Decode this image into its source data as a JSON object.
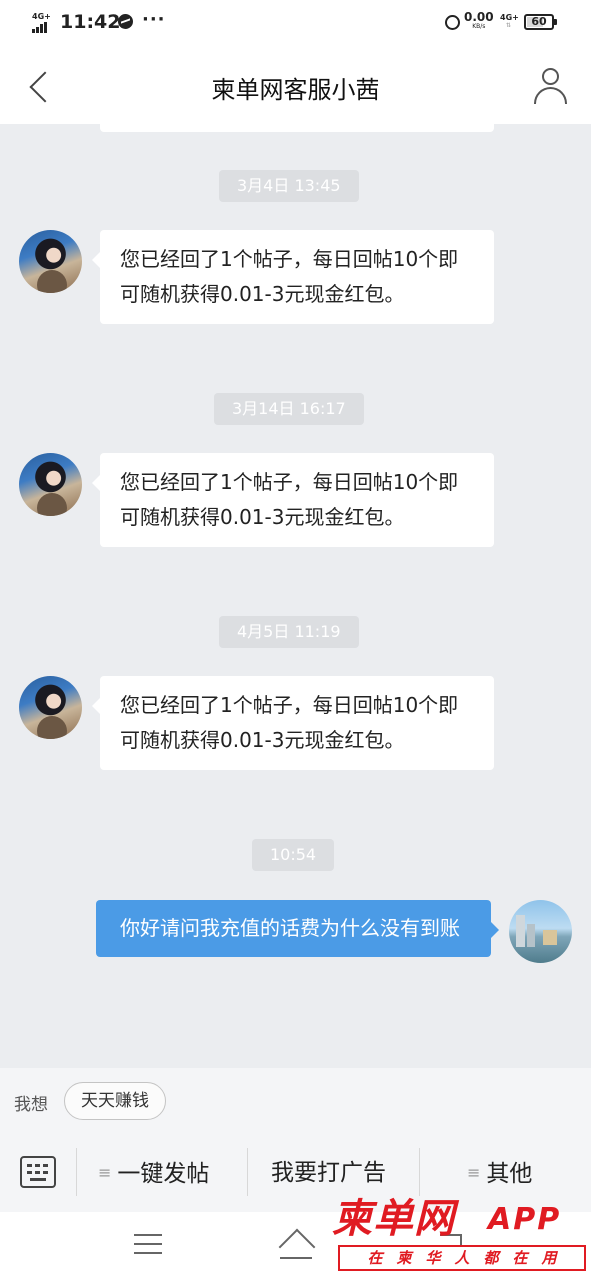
{
  "status_bar": {
    "network_left": "4G+",
    "time": "11:42",
    "more": "···",
    "speed_value": "0.00",
    "speed_unit": "KB/s",
    "network_right": "4G+",
    "battery": "60",
    "icons": [
      "signal-icon",
      "messenger-icon",
      "alarm-icon",
      "battery-icon"
    ]
  },
  "header": {
    "title": "柬单网客服小茜",
    "icons": [
      "back-icon",
      "profile-icon"
    ]
  },
  "chat": {
    "messages": [
      {
        "timestamp": "3月4日 13:45",
        "side": "left",
        "text": "您已经回了1个帖子，每日回帖10个即可随机获得0.01-3元现金红包。"
      },
      {
        "timestamp": "3月14日 16:17",
        "side": "left",
        "text": "您已经回了1个帖子，每日回帖10个即可随机获得0.01-3元现金红包。"
      },
      {
        "timestamp": "4月5日 11:19",
        "side": "left",
        "text": "您已经回了1个帖子，每日回帖10个即可随机获得0.01-3元现金红包。"
      },
      {
        "timestamp": "10:54",
        "side": "right",
        "text": "你好请问我充值的话费为什么没有到账"
      }
    ]
  },
  "suggestions": {
    "label": "我想",
    "chip": "天天赚钱"
  },
  "menu": {
    "items": [
      {
        "label": "一键发帖",
        "glyph": "≡"
      },
      {
        "label": "我要打广告"
      },
      {
        "label": "其他",
        "glyph": "≡"
      }
    ],
    "icons": [
      "keyboard-icon",
      "menu-lines-icon"
    ]
  },
  "watermark": {
    "brand": "柬单网",
    "suffix": "APP",
    "slogan": "在柬华人都在用"
  },
  "colors": {
    "chat_background": "#ebedf0",
    "outgoing_bubble": "#4b9be6",
    "incoming_bubble": "#ffffff",
    "watermark_red": "#e01b22"
  }
}
